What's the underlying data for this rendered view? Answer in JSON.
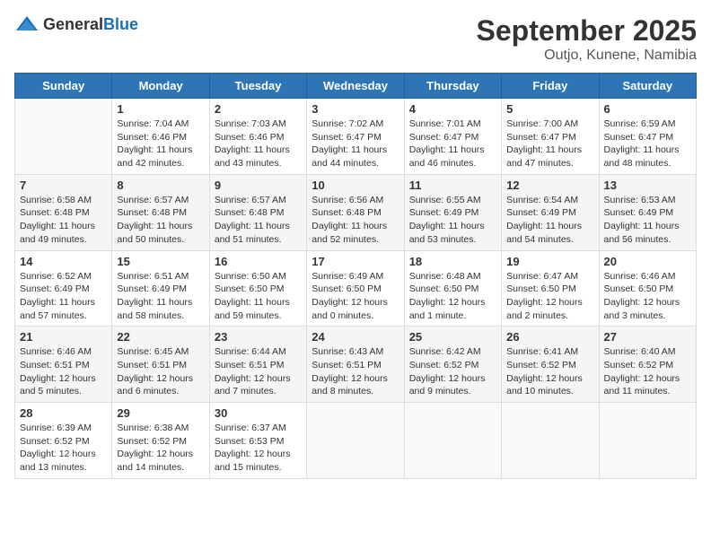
{
  "logo": {
    "general": "General",
    "blue": "Blue"
  },
  "header": {
    "month": "September 2025",
    "location": "Outjo, Kunene, Namibia"
  },
  "days_of_week": [
    "Sunday",
    "Monday",
    "Tuesday",
    "Wednesday",
    "Thursday",
    "Friday",
    "Saturday"
  ],
  "weeks": [
    [
      {
        "day": "",
        "content": ""
      },
      {
        "day": "1",
        "content": "Sunrise: 7:04 AM\nSunset: 6:46 PM\nDaylight: 11 hours\nand 42 minutes."
      },
      {
        "day": "2",
        "content": "Sunrise: 7:03 AM\nSunset: 6:46 PM\nDaylight: 11 hours\nand 43 minutes."
      },
      {
        "day": "3",
        "content": "Sunrise: 7:02 AM\nSunset: 6:47 PM\nDaylight: 11 hours\nand 44 minutes."
      },
      {
        "day": "4",
        "content": "Sunrise: 7:01 AM\nSunset: 6:47 PM\nDaylight: 11 hours\nand 46 minutes."
      },
      {
        "day": "5",
        "content": "Sunrise: 7:00 AM\nSunset: 6:47 PM\nDaylight: 11 hours\nand 47 minutes."
      },
      {
        "day": "6",
        "content": "Sunrise: 6:59 AM\nSunset: 6:47 PM\nDaylight: 11 hours\nand 48 minutes."
      }
    ],
    [
      {
        "day": "7",
        "content": "Sunrise: 6:58 AM\nSunset: 6:48 PM\nDaylight: 11 hours\nand 49 minutes."
      },
      {
        "day": "8",
        "content": "Sunrise: 6:57 AM\nSunset: 6:48 PM\nDaylight: 11 hours\nand 50 minutes."
      },
      {
        "day": "9",
        "content": "Sunrise: 6:57 AM\nSunset: 6:48 PM\nDaylight: 11 hours\nand 51 minutes."
      },
      {
        "day": "10",
        "content": "Sunrise: 6:56 AM\nSunset: 6:48 PM\nDaylight: 11 hours\nand 52 minutes."
      },
      {
        "day": "11",
        "content": "Sunrise: 6:55 AM\nSunset: 6:49 PM\nDaylight: 11 hours\nand 53 minutes."
      },
      {
        "day": "12",
        "content": "Sunrise: 6:54 AM\nSunset: 6:49 PM\nDaylight: 11 hours\nand 54 minutes."
      },
      {
        "day": "13",
        "content": "Sunrise: 6:53 AM\nSunset: 6:49 PM\nDaylight: 11 hours\nand 56 minutes."
      }
    ],
    [
      {
        "day": "14",
        "content": "Sunrise: 6:52 AM\nSunset: 6:49 PM\nDaylight: 11 hours\nand 57 minutes."
      },
      {
        "day": "15",
        "content": "Sunrise: 6:51 AM\nSunset: 6:49 PM\nDaylight: 11 hours\nand 58 minutes."
      },
      {
        "day": "16",
        "content": "Sunrise: 6:50 AM\nSunset: 6:50 PM\nDaylight: 11 hours\nand 59 minutes."
      },
      {
        "day": "17",
        "content": "Sunrise: 6:49 AM\nSunset: 6:50 PM\nDaylight: 12 hours\nand 0 minutes."
      },
      {
        "day": "18",
        "content": "Sunrise: 6:48 AM\nSunset: 6:50 PM\nDaylight: 12 hours\nand 1 minute."
      },
      {
        "day": "19",
        "content": "Sunrise: 6:47 AM\nSunset: 6:50 PM\nDaylight: 12 hours\nand 2 minutes."
      },
      {
        "day": "20",
        "content": "Sunrise: 6:46 AM\nSunset: 6:50 PM\nDaylight: 12 hours\nand 3 minutes."
      }
    ],
    [
      {
        "day": "21",
        "content": "Sunrise: 6:46 AM\nSunset: 6:51 PM\nDaylight: 12 hours\nand 5 minutes."
      },
      {
        "day": "22",
        "content": "Sunrise: 6:45 AM\nSunset: 6:51 PM\nDaylight: 12 hours\nand 6 minutes."
      },
      {
        "day": "23",
        "content": "Sunrise: 6:44 AM\nSunset: 6:51 PM\nDaylight: 12 hours\nand 7 minutes."
      },
      {
        "day": "24",
        "content": "Sunrise: 6:43 AM\nSunset: 6:51 PM\nDaylight: 12 hours\nand 8 minutes."
      },
      {
        "day": "25",
        "content": "Sunrise: 6:42 AM\nSunset: 6:52 PM\nDaylight: 12 hours\nand 9 minutes."
      },
      {
        "day": "26",
        "content": "Sunrise: 6:41 AM\nSunset: 6:52 PM\nDaylight: 12 hours\nand 10 minutes."
      },
      {
        "day": "27",
        "content": "Sunrise: 6:40 AM\nSunset: 6:52 PM\nDaylight: 12 hours\nand 11 minutes."
      }
    ],
    [
      {
        "day": "28",
        "content": "Sunrise: 6:39 AM\nSunset: 6:52 PM\nDaylight: 12 hours\nand 13 minutes."
      },
      {
        "day": "29",
        "content": "Sunrise: 6:38 AM\nSunset: 6:52 PM\nDaylight: 12 hours\nand 14 minutes."
      },
      {
        "day": "30",
        "content": "Sunrise: 6:37 AM\nSunset: 6:53 PM\nDaylight: 12 hours\nand 15 minutes."
      },
      {
        "day": "",
        "content": ""
      },
      {
        "day": "",
        "content": ""
      },
      {
        "day": "",
        "content": ""
      },
      {
        "day": "",
        "content": ""
      }
    ]
  ]
}
